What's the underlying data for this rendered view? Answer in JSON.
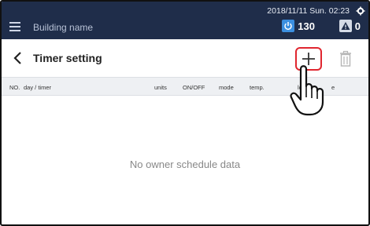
{
  "header": {
    "building_name": "Building name",
    "datetime": "2018/11/11 Sun. 02:23",
    "power_count": "130",
    "alarm_count": "0",
    "icons": {
      "menu": "menu-icon",
      "settings": "gear-icon",
      "power": "power-icon",
      "alarm": "alarm-icon"
    }
  },
  "titlebar": {
    "title": "Timer setting",
    "back_icon": "chevron-left-icon",
    "add_icon": "plus-icon",
    "delete_icon": "trash-icon"
  },
  "table": {
    "columns": {
      "no": "NO.",
      "day_timer": "day / timer",
      "units": "units",
      "onoff": "ON/OFF",
      "mode": "mode",
      "temp": "temp.",
      "louver": "lo",
      "fan": "e"
    },
    "empty_message": "No owner schedule data"
  },
  "colors": {
    "topbar": "#1f2d4a",
    "power_badge": "#3b8fe0",
    "highlight": "#e0262f"
  }
}
